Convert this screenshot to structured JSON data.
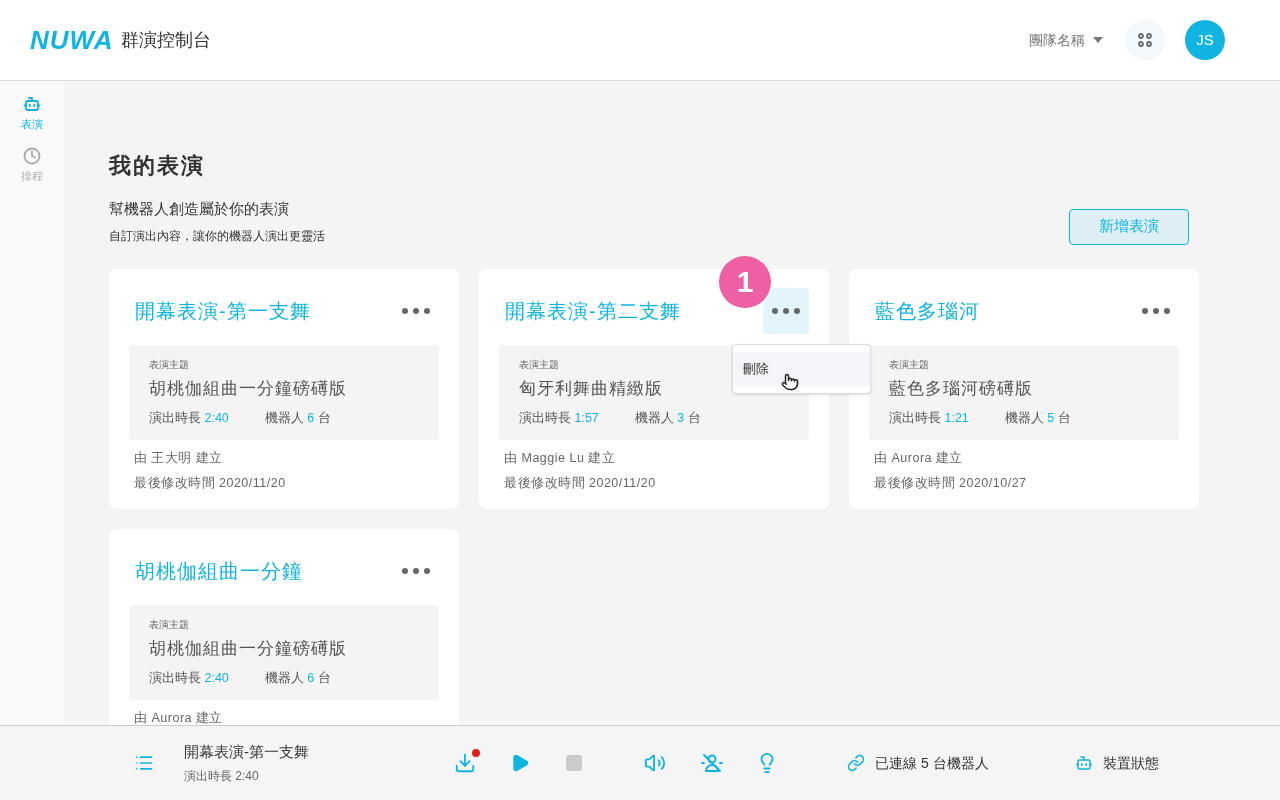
{
  "header": {
    "logo": "NUWA",
    "title": "群演控制台",
    "team": "團隊名稱",
    "avatar": "JS"
  },
  "sidebar": {
    "items": [
      {
        "label": "表演",
        "kind": "robot",
        "selected": true
      },
      {
        "label": "排程",
        "kind": "clock",
        "selected": false
      }
    ]
  },
  "page": {
    "title": "我的表演",
    "subtitle": "幫機器人創造屬於你的表演",
    "description": "自訂演出內容，讓你的機器人演出更靈活",
    "new_button": "新增表演"
  },
  "cards": [
    {
      "title": "開幕表演-第一支舞",
      "theme_label": "表演主題",
      "theme": "胡桃伽組曲一分鐘磅礡版",
      "duration_label": "演出時長",
      "duration": "2:40",
      "robots_label": "機器人",
      "robots_count": "6",
      "robots_unit": "台",
      "creator": "由 王大明 建立",
      "modified": "最後修改時間  2020/11/20",
      "menu_open": false
    },
    {
      "title": "開幕表演-第二支舞",
      "theme_label": "表演主題",
      "theme": "匈牙利舞曲精緻版",
      "duration_label": "演出時長",
      "duration": "1:57",
      "robots_label": "機器人",
      "robots_count": "3",
      "robots_unit": "台",
      "creator": "由 Maggie Lu 建立",
      "modified": "最後修改時間  2020/11/20",
      "menu_open": true,
      "step_badge": "1",
      "menu_items": [
        "刪除"
      ]
    },
    {
      "title": "藍色多瑙河",
      "theme_label": "表演主題",
      "theme": "藍色多瑙河磅礡版",
      "duration_label": "演出時長",
      "duration": "1:21",
      "robots_label": "機器人",
      "robots_count": "5",
      "robots_unit": "台",
      "creator": "由 Aurora 建立",
      "modified": "最後修改時間  2020/10/27",
      "menu_open": false
    },
    {
      "title": "胡桃伽組曲一分鐘",
      "theme_label": "表演主題",
      "theme": "胡桃伽組曲一分鐘磅礡版",
      "duration_label": "演出時長",
      "duration": "2:40",
      "robots_label": "機器人",
      "robots_count": "6",
      "robots_unit": "台",
      "creator": "由 Aurora 建立",
      "menu_open": false
    }
  ],
  "player": {
    "title": "開幕表演-第一支舞",
    "duration": "演出時長 2:40",
    "download_notification": true,
    "connection": "已連線 5 台機器人",
    "device_status": "裝置狀態"
  }
}
